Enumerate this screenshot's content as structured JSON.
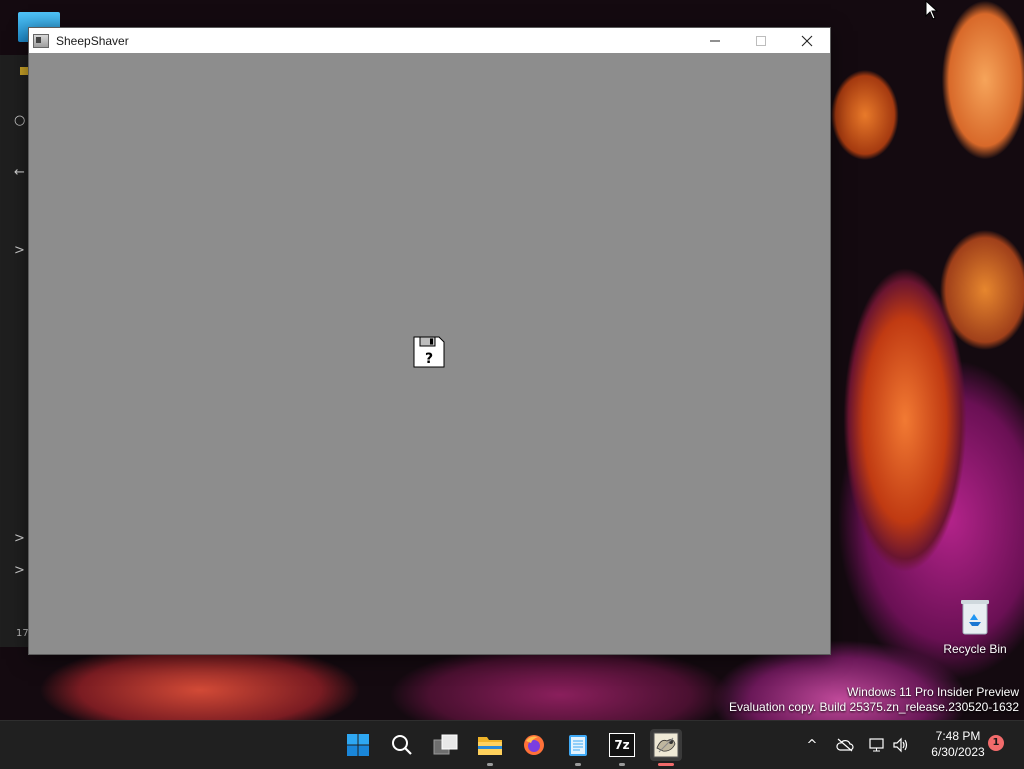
{
  "window": {
    "title": "SheepShaver",
    "icons": {
      "app": "sheepshaver-app-icon",
      "minimize": "minimize-icon",
      "maximize": "maximize-icon",
      "close": "close-icon"
    },
    "screen_icon": "floppy-disk-question-icon",
    "floppy_label": "?"
  },
  "background_window": {
    "chevrons": [
      ">",
      ">",
      ">"
    ],
    "back_arrow": "←",
    "status_text": "17"
  },
  "desktop": {
    "recycle_bin_label": "Recycle Bin",
    "watermark_line1": "Windows 11 Pro Insider Preview",
    "watermark_line2": "Evaluation copy. Build 25375.zn_release.230520-1632"
  },
  "taskbar": {
    "pinned": [
      {
        "name": "start-button",
        "icon": "windows-logo-icon"
      },
      {
        "name": "search-button",
        "icon": "search-icon"
      },
      {
        "name": "task-view-button",
        "icon": "task-view-icon"
      },
      {
        "name": "file-explorer-button",
        "icon": "folder-icon"
      },
      {
        "name": "firefox-button",
        "icon": "firefox-icon"
      },
      {
        "name": "notepad-button",
        "icon": "notepad-icon"
      },
      {
        "name": "7zip-button",
        "icon": "7zip-icon",
        "label": "7z"
      },
      {
        "name": "sheepshaver-button",
        "icon": "sheepshaver-icon"
      }
    ],
    "tray": {
      "overflow_arrow": "^",
      "clock_time": "7:48 PM",
      "clock_date": "6/30/2023",
      "notification_count": "1"
    }
  },
  "colors": {
    "emulator_gray": "#8d8d8d",
    "taskbar": "#202020",
    "accent_red": "#f26b6b"
  }
}
